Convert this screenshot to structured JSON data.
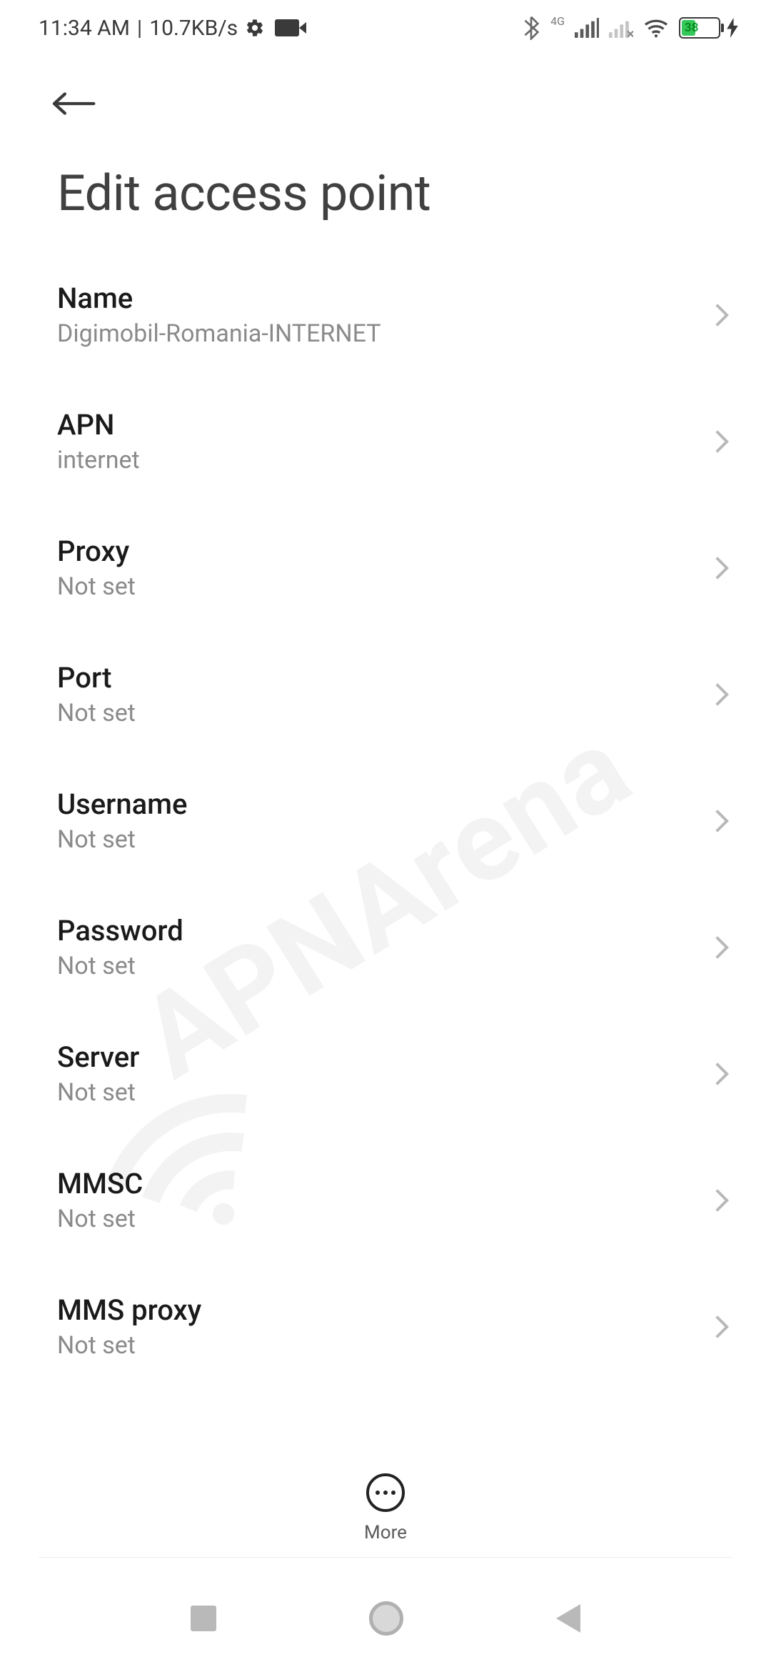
{
  "status": {
    "time": "11:34 AM",
    "sep": "|",
    "net_speed": "10.7KB/s",
    "cell_type": "4G",
    "battery_pct": "38"
  },
  "header": {
    "title": "Edit access point"
  },
  "settings": [
    {
      "label": "Name",
      "value": "Digimobil-Romania-INTERNET"
    },
    {
      "label": "APN",
      "value": "internet"
    },
    {
      "label": "Proxy",
      "value": "Not set"
    },
    {
      "label": "Port",
      "value": "Not set"
    },
    {
      "label": "Username",
      "value": "Not set"
    },
    {
      "label": "Password",
      "value": "Not set"
    },
    {
      "label": "Server",
      "value": "Not set"
    },
    {
      "label": "MMSC",
      "value": "Not set"
    },
    {
      "label": "MMS proxy",
      "value": "Not set"
    }
  ],
  "more": {
    "label": "More"
  },
  "watermark": "APNArena"
}
